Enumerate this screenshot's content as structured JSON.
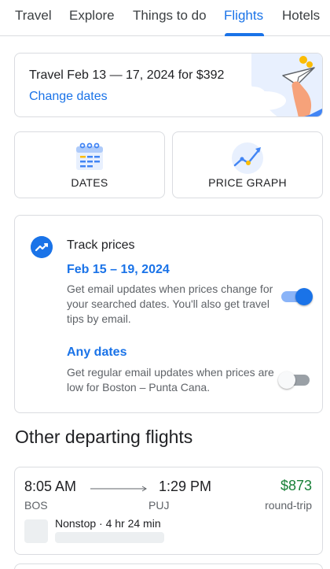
{
  "tabs": [
    {
      "label": "Travel"
    },
    {
      "label": "Explore"
    },
    {
      "label": "Things to do"
    },
    {
      "label": "Flights"
    },
    {
      "label": "Hotels"
    }
  ],
  "active_tab": "Flights",
  "promo": {
    "text": "Travel Feb 13 — 17, 2024 for $392",
    "link": "Change dates"
  },
  "options": {
    "dates_label": "DATES",
    "price_graph_label": "PRICE GRAPH"
  },
  "track": {
    "title": "Track prices",
    "specific": {
      "title": "Feb 15 – 19, 2024",
      "description": "Get email updates when prices change for your searched dates. You'll also get travel tips by email.",
      "enabled": true
    },
    "any": {
      "title": "Any dates",
      "description": "Get regular email updates when prices are low for Boston – Punta Cana.",
      "enabled": false
    }
  },
  "section_title": "Other departing flights",
  "flight": {
    "depart_time": "8:05 AM",
    "arrive_time": "1:29 PM",
    "from": "BOS",
    "to": "PUJ",
    "price": "$873",
    "trip_type": "round-trip",
    "stops": "Nonstop · 4 hr 24 min"
  },
  "colors": {
    "accent": "#1a73e8",
    "price_green": "#188038"
  }
}
